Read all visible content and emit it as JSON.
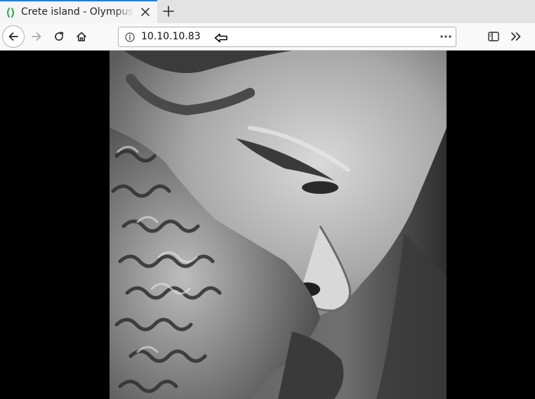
{
  "browser": {
    "tab": {
      "title": "Crete island - Olympus HTB"
    },
    "url": "10.10.10.83"
  },
  "page": {
    "image": {
      "subject": "marble-bust-of-zeus"
    }
  },
  "icons": {
    "favicon": "parenthesis-favicon-icon",
    "close": "close-icon",
    "new_tab": "plus-icon",
    "back": "arrow-left-icon",
    "forward": "arrow-right-icon",
    "reload": "reload-icon",
    "home": "home-icon",
    "info": "info-icon",
    "more": "ellipsis-icon",
    "sidebar": "sidebar-icon",
    "overflow": "chevron-double-right-icon",
    "cursor": "arrow-cursor-icon"
  },
  "colors": {
    "tab_accent": "#0a84ff",
    "favicon": "#2fa84f",
    "chrome_bg": "#e3e3e3",
    "toolbar_bg": "#f9f9fa",
    "page_bg": "#000000"
  }
}
